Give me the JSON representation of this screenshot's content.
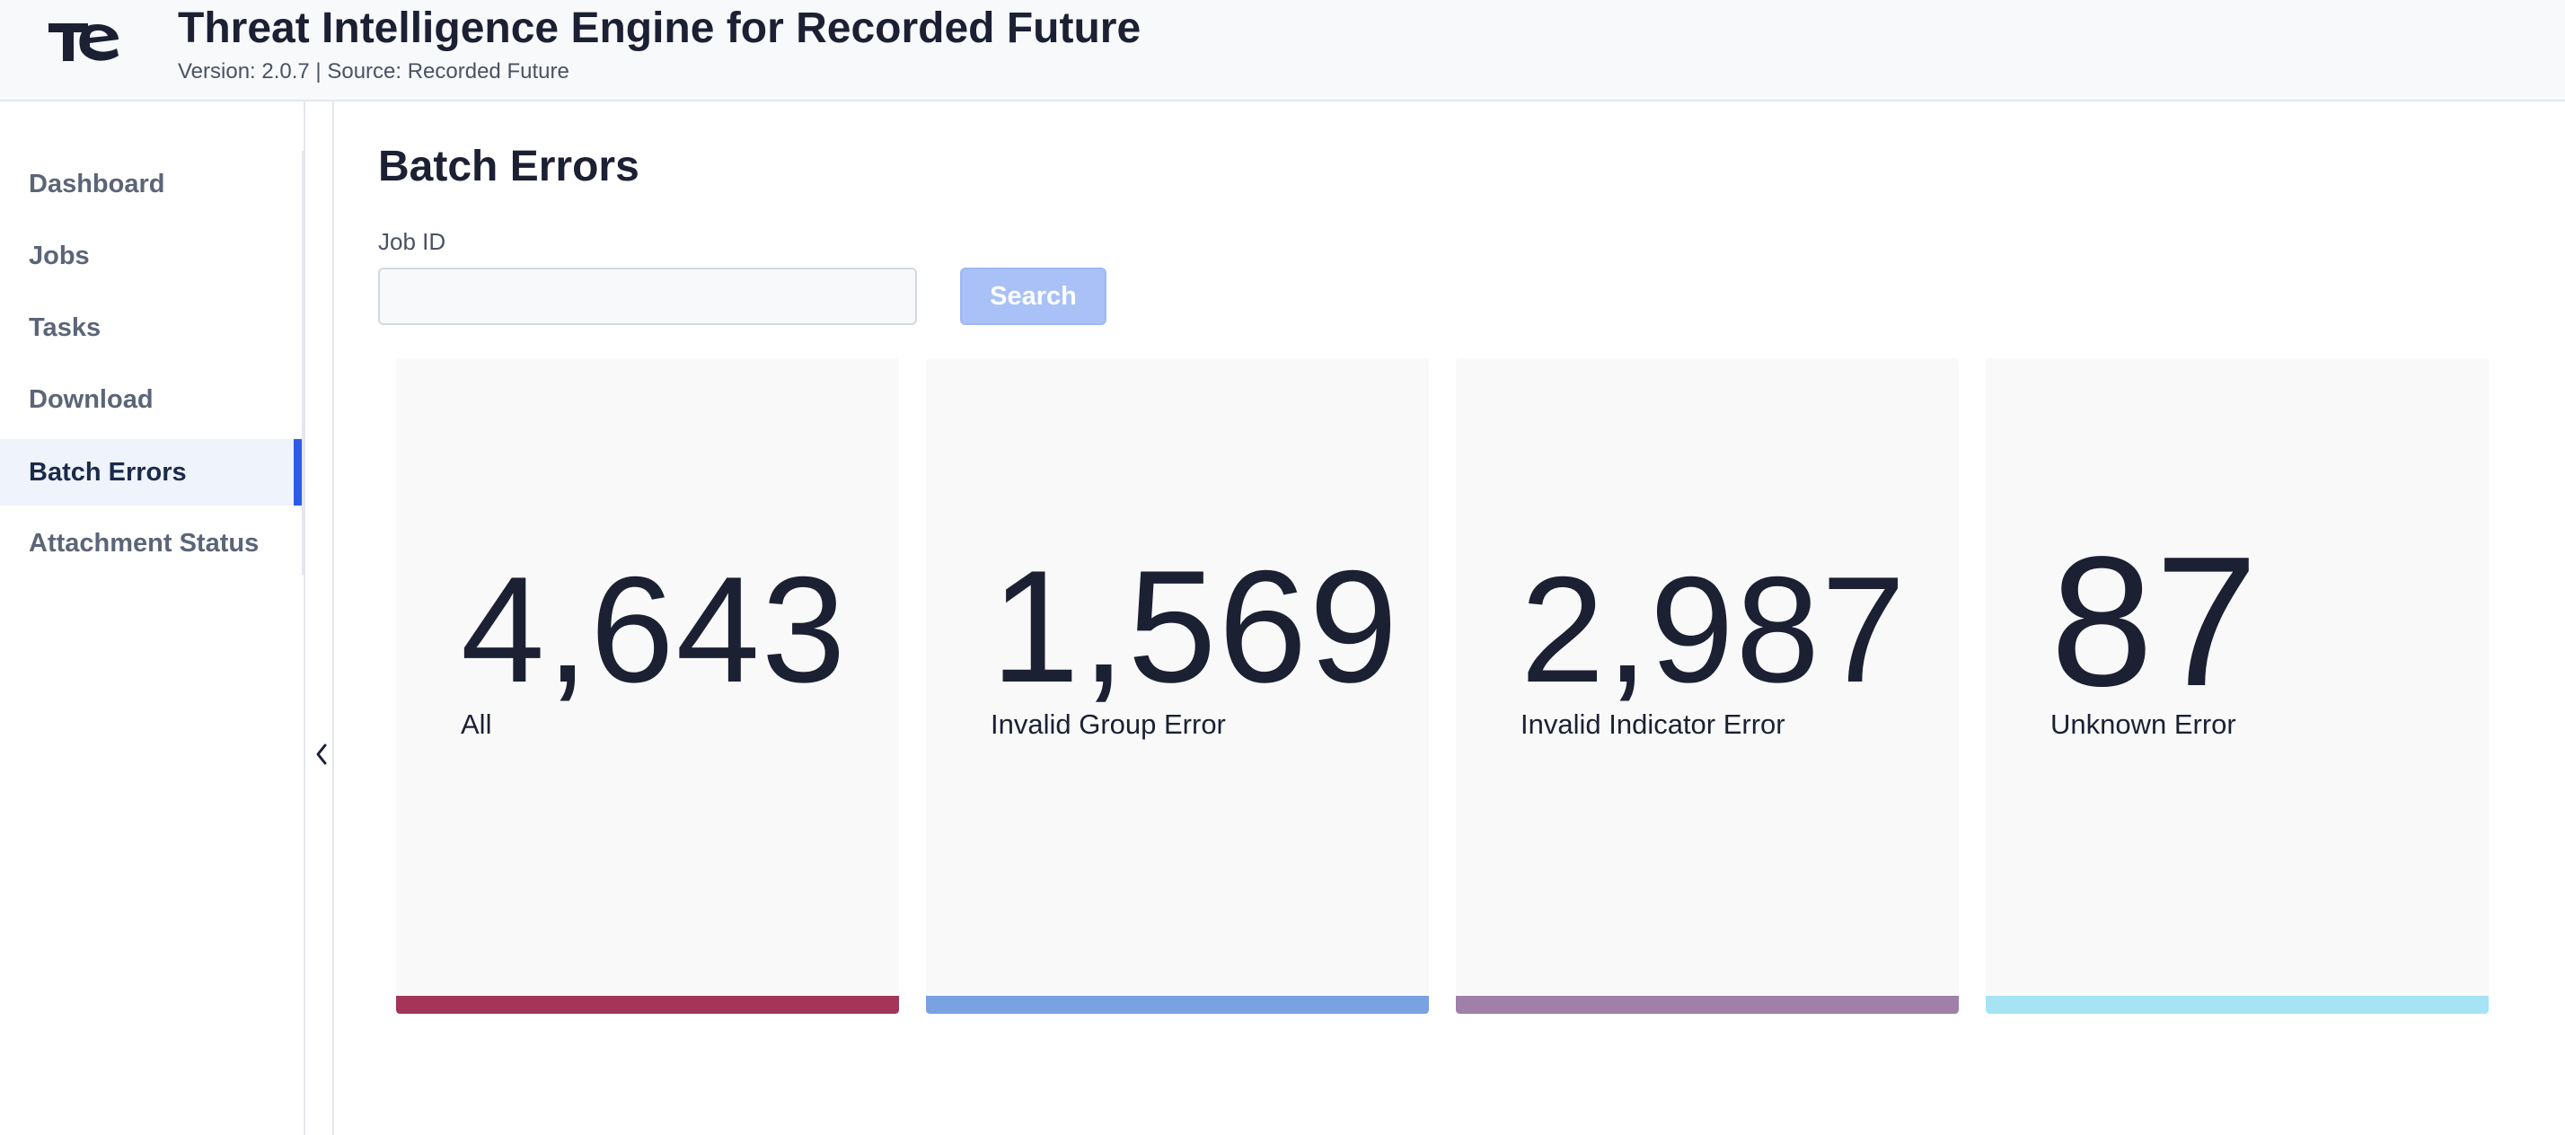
{
  "header": {
    "title": "Threat Intelligence Engine for Recorded Future",
    "subtitle": "Version: 2.0.7 | Source: Recorded Future",
    "logo_icon": "te-logo-icon"
  },
  "sidebar": {
    "items": [
      {
        "label": "Dashboard",
        "active": false
      },
      {
        "label": "Jobs",
        "active": false
      },
      {
        "label": "Tasks",
        "active": false
      },
      {
        "label": "Download",
        "active": false
      },
      {
        "label": "Batch Errors",
        "active": true
      },
      {
        "label": "Attachment Status",
        "active": false
      }
    ],
    "collapse_icon": "chevron-left-icon",
    "active_color": "#2e5be6"
  },
  "main": {
    "page_title": "Batch Errors",
    "job_id": {
      "label": "Job ID",
      "value": "",
      "placeholder": ""
    },
    "search_label": "Search",
    "cards": [
      {
        "value": "4,643",
        "label": "All",
        "color": "#a33558"
      },
      {
        "value": "1,569",
        "label": "Invalid Group Error",
        "color": "#7aa1e2"
      },
      {
        "value": "2,987",
        "label": "Invalid Indicator Error",
        "color": "#a07fa8"
      },
      {
        "value": "87",
        "label": "Unknown Error",
        "color": "#a6e3f5"
      }
    ]
  }
}
